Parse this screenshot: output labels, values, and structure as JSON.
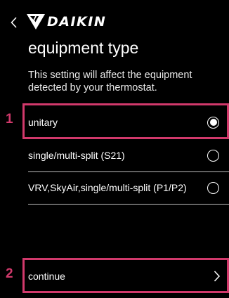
{
  "header": {
    "brand": "DAIKIN",
    "back_icon": "chevron-left-icon",
    "logo_icon": "daikin-triangle-logo"
  },
  "page": {
    "title": "equipment type",
    "description": "This setting will affect the equipment detected by your thermostat."
  },
  "options": [
    {
      "label": "unitary",
      "selected": true
    },
    {
      "label": "single/multi-split (S21)",
      "selected": false
    },
    {
      "label": "VRV,SkyAir,single/multi-split (P1/P2)",
      "selected": false
    }
  ],
  "continue": {
    "label": "continue",
    "icon": "chevron-right-icon"
  },
  "annotations": {
    "callout_1": "1",
    "callout_2": "2",
    "color": "#d1396b"
  },
  "colors": {
    "background": "#000000",
    "text": "#ffffff",
    "divider": "#bdbdbd",
    "annotation": "#d1396b"
  }
}
